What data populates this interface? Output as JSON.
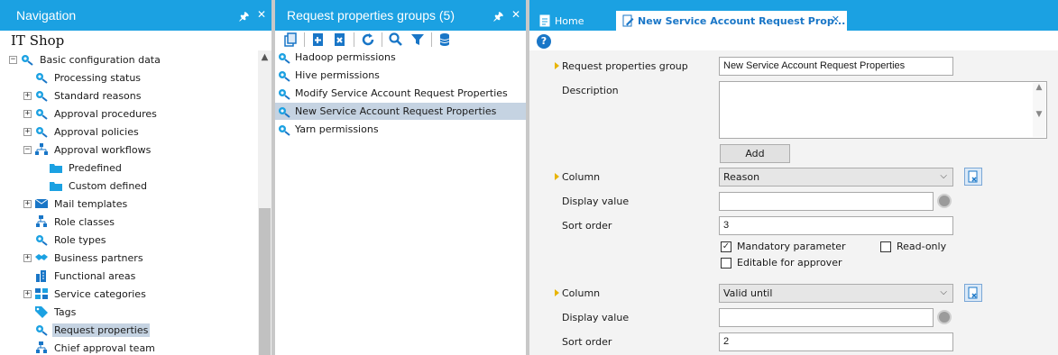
{
  "navigation": {
    "title": "Navigation",
    "root_title": "IT Shop",
    "items": [
      {
        "label": "Basic configuration data",
        "icon": "gear-connector-icon",
        "expander": "−"
      },
      {
        "label": "Processing status",
        "icon": "gear-connector-icon",
        "expander": ""
      },
      {
        "label": "Standard reasons",
        "icon": "gear-connector-icon",
        "expander": "+"
      },
      {
        "label": "Approval procedures",
        "icon": "gear-connector-icon",
        "expander": "+"
      },
      {
        "label": "Approval policies",
        "icon": "gear-connector-icon",
        "expander": "+"
      },
      {
        "label": "Approval workflows",
        "icon": "workflow-icon",
        "expander": "−"
      },
      {
        "label": "Predefined",
        "icon": "folder-icon",
        "expander": ""
      },
      {
        "label": "Custom defined",
        "icon": "folder-icon",
        "expander": ""
      },
      {
        "label": "Mail templates",
        "icon": "mail-icon",
        "expander": "+"
      },
      {
        "label": "Role classes",
        "icon": "hierarchy-icon",
        "expander": ""
      },
      {
        "label": "Role types",
        "icon": "gear-connector-icon",
        "expander": ""
      },
      {
        "label": "Business partners",
        "icon": "handshake-icon",
        "expander": "+"
      },
      {
        "label": "Functional areas",
        "icon": "building-icon",
        "expander": ""
      },
      {
        "label": "Service categories",
        "icon": "service-category-icon",
        "expander": "+"
      },
      {
        "label": "Tags",
        "icon": "tag-icon",
        "expander": ""
      },
      {
        "label": "Request properties",
        "icon": "gear-connector-icon",
        "expander": "",
        "selected": true
      },
      {
        "label": "Chief approval team",
        "icon": "hierarchy-icon",
        "expander": ""
      }
    ]
  },
  "groups_pane": {
    "title": "Request properties groups (5)",
    "toolbar_icons": [
      "copy-icon",
      "new-item-icon",
      "delete-icon",
      "refresh-icon",
      "search-icon",
      "filter-icon",
      "database-icon"
    ],
    "items": [
      {
        "label": "Hadoop permissions"
      },
      {
        "label": "Hive permissions"
      },
      {
        "label": "Modify Service Account Request Properties"
      },
      {
        "label": "New Service Account Request Properties",
        "selected": true
      },
      {
        "label": "Yarn permissions"
      }
    ]
  },
  "detail": {
    "tab_home": "Home",
    "tab_active": "New Service Account Request Prop...",
    "help_symbol": "?",
    "form": {
      "group_label": "Request properties group",
      "group_value": "New Service Account Request Properties",
      "description_label": "Description",
      "description_value": "",
      "add_button": "Add",
      "column1": {
        "label": "Column",
        "value": "Reason",
        "display_label": "Display value",
        "display_value": "",
        "sort_label": "Sort order",
        "sort_value": "3"
      },
      "mandatory_label": "Mandatory parameter",
      "mandatory_checked": true,
      "readonly_label": "Read-only",
      "readonly_checked": false,
      "editable_label": "Editable for approver",
      "editable_checked": false,
      "column2": {
        "label": "Column",
        "value": "Valid until",
        "display_label": "Display value",
        "display_value": "",
        "sort_label": "Sort order",
        "sort_value": "2"
      }
    }
  },
  "colors": {
    "accent": "#1ba1e2",
    "selection": "#c5d3e2",
    "link": "#1976c7",
    "mandatory_marker": "#e8b400"
  }
}
